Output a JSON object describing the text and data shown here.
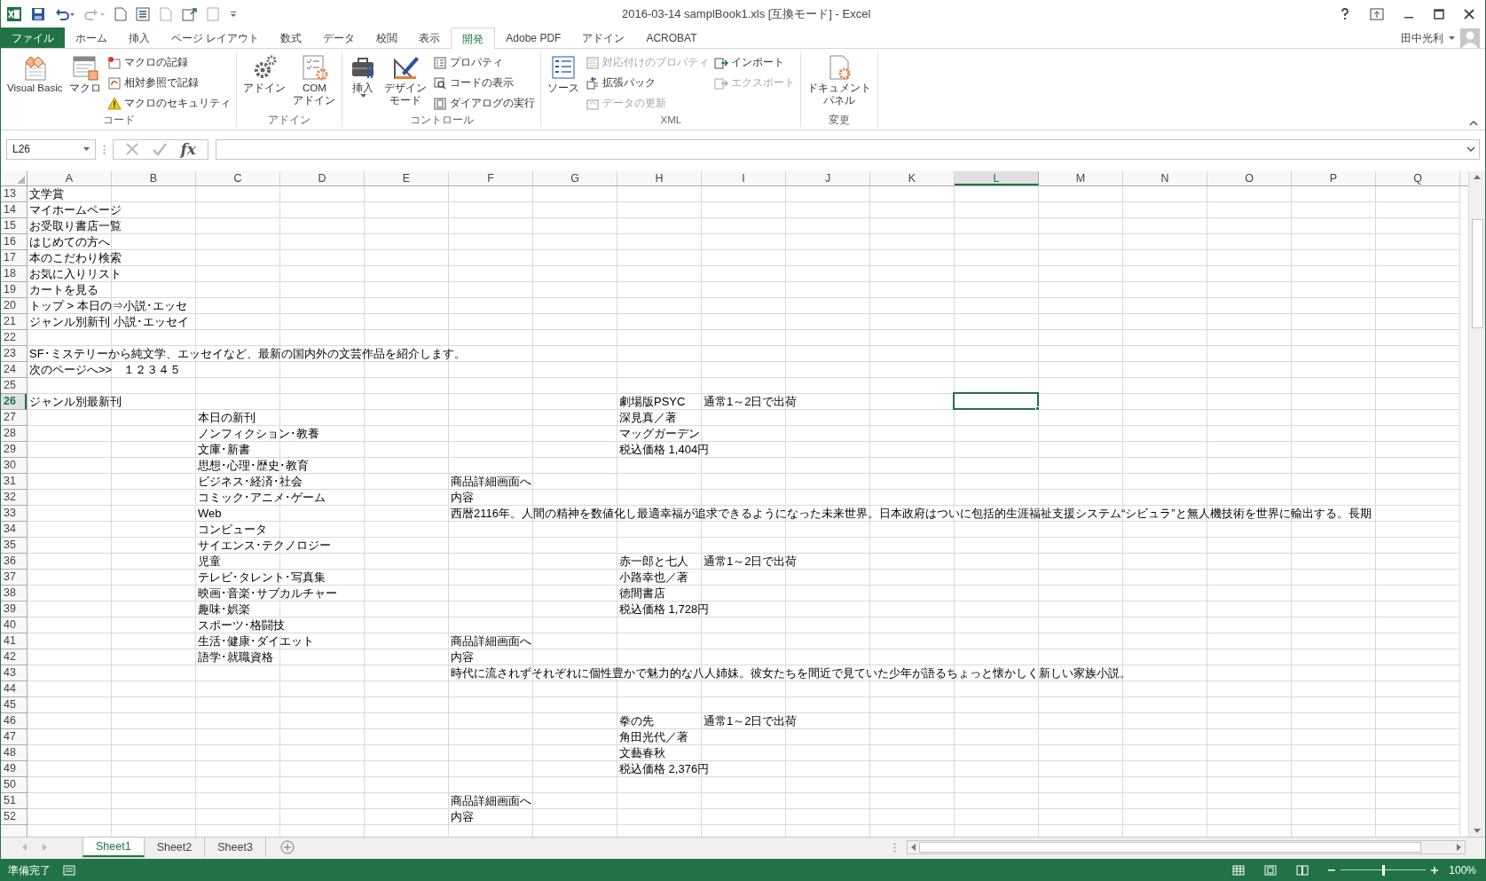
{
  "window": {
    "title": "2016-03-14 samplBook1.xls  [互換モード] - Excel",
    "user": "田中光利"
  },
  "tabs": [
    {
      "label": "ファイル",
      "kind": "file",
      "selected": false
    },
    {
      "label": "ホーム",
      "kind": "tab",
      "selected": false
    },
    {
      "label": "挿入",
      "kind": "tab",
      "selected": false
    },
    {
      "label": "ページ レイアウト",
      "kind": "tab",
      "selected": false
    },
    {
      "label": "数式",
      "kind": "tab",
      "selected": false
    },
    {
      "label": "データ",
      "kind": "tab",
      "selected": false
    },
    {
      "label": "校閲",
      "kind": "tab",
      "selected": false
    },
    {
      "label": "表示",
      "kind": "tab",
      "selected": false
    },
    {
      "label": "開発",
      "kind": "tab",
      "selected": true
    },
    {
      "label": "Adobe PDF",
      "kind": "tab",
      "selected": false
    },
    {
      "label": "アドイン",
      "kind": "tab",
      "selected": false
    },
    {
      "label": "ACROBAT",
      "kind": "tab",
      "selected": false
    }
  ],
  "ribbon": [
    {
      "label": "コード",
      "items": [
        {
          "kind": "large",
          "lines": [
            "Visual Basic"
          ],
          "disabled": false
        },
        {
          "kind": "large",
          "lines": [
            "マクロ"
          ],
          "disabled": false
        },
        {
          "kind": "small",
          "label": "マクロの記録",
          "disabled": false
        },
        {
          "kind": "small",
          "label": "相対参照で記録",
          "disabled": false
        },
        {
          "kind": "small",
          "label": "マクロのセキュリティ",
          "disabled": false
        }
      ]
    },
    {
      "label": "アドイン",
      "items": [
        {
          "kind": "large",
          "lines": [
            "アドイン"
          ],
          "disabled": false
        },
        {
          "kind": "large",
          "lines": [
            "COM",
            "アドイン"
          ],
          "disabled": false
        }
      ]
    },
    {
      "label": "コントロール",
      "items": [
        {
          "kind": "large",
          "lines": [
            "挿入"
          ],
          "disabled": false
        },
        {
          "kind": "large",
          "lines": [
            "デザイン",
            "モード"
          ],
          "disabled": false
        },
        {
          "kind": "small",
          "label": "プロパティ",
          "disabled": false
        },
        {
          "kind": "small",
          "label": "コードの表示",
          "disabled": false
        },
        {
          "kind": "small",
          "label": "ダイアログの実行",
          "disabled": false
        }
      ]
    },
    {
      "label": "XML",
      "items": [
        {
          "kind": "large",
          "lines": [
            "ソース"
          ],
          "disabled": false
        },
        {
          "kind": "small",
          "label": "対応付けのプロパティ",
          "disabled": true
        },
        {
          "kind": "small",
          "label": "拡張パック",
          "disabled": false
        },
        {
          "kind": "small",
          "label": "データの更新",
          "disabled": true
        },
        {
          "kind": "small",
          "label": "インポート",
          "disabled": false
        },
        {
          "kind": "small",
          "label": "エクスポート",
          "disabled": true
        }
      ]
    },
    {
      "label": "変更",
      "items": [
        {
          "kind": "large",
          "lines": [
            "ドキュメント",
            "パネル"
          ],
          "disabled": false
        }
      ]
    }
  ],
  "formula_bar": {
    "name_box": "L26",
    "function_label": "fx"
  },
  "columns": [
    {
      "label": "A",
      "selected": false
    },
    {
      "label": "B",
      "selected": false
    },
    {
      "label": "C",
      "selected": false
    },
    {
      "label": "D",
      "selected": false
    },
    {
      "label": "E",
      "selected": false
    },
    {
      "label": "F",
      "selected": false
    },
    {
      "label": "G",
      "selected": false
    },
    {
      "label": "H",
      "selected": false
    },
    {
      "label": "I",
      "selected": false
    },
    {
      "label": "J",
      "selected": false
    },
    {
      "label": "K",
      "selected": false
    },
    {
      "label": "L",
      "selected": true
    },
    {
      "label": "M",
      "selected": false
    },
    {
      "label": "N",
      "selected": false
    },
    {
      "label": "O",
      "selected": false
    },
    {
      "label": "P",
      "selected": false
    },
    {
      "label": "Q",
      "selected": false
    }
  ],
  "rows": [
    {
      "number": "13",
      "selected": false,
      "cells": {
        "A": "文学賞"
      }
    },
    {
      "number": "14",
      "selected": false,
      "cells": {
        "A": "マイホームページ"
      }
    },
    {
      "number": "15",
      "selected": false,
      "cells": {
        "A": "お受取り書店一覧"
      }
    },
    {
      "number": "16",
      "selected": false,
      "cells": {
        "A": "はじめての方へ"
      }
    },
    {
      "number": "17",
      "selected": false,
      "cells": {
        "A": "本のこだわり検索"
      }
    },
    {
      "number": "18",
      "selected": false,
      "cells": {
        "A": "お気に入りリスト"
      }
    },
    {
      "number": "19",
      "selected": false,
      "cells": {
        "A": "カートを見る"
      }
    },
    {
      "number": "20",
      "selected": false,
      "cells": {
        "A": "トップ > 本日の⇒小説･エッセ"
      }
    },
    {
      "number": "21",
      "selected": false,
      "cells": {
        "A": "ジャンル別新刊 小説･エッセイ"
      }
    },
    {
      "number": "22",
      "selected": false
    },
    {
      "number": "23",
      "selected": false,
      "cells": {
        "A": "SF･ミステリーから純文学、エッセイなど、最新の国内外の文芸作品を紹介します。"
      }
    },
    {
      "number": "24",
      "selected": false,
      "cells": {
        "A": "次のページへ>>　１２３４５"
      }
    },
    {
      "number": "25",
      "selected": false
    },
    {
      "number": "26",
      "selected": true,
      "cells": {
        "A": "ジャンル別最新刊",
        "H": "劇場版PSYC",
        "I": "通常1～2日で出荷"
      }
    },
    {
      "number": "27",
      "selected": false,
      "cells": {
        "C": "本日の新刊",
        "H": "深見真／著"
      }
    },
    {
      "number": "28",
      "selected": false,
      "cells": {
        "C": "ノンフィクション･教養",
        "H": "マッグガーデン"
      }
    },
    {
      "number": "29",
      "selected": false,
      "cells": {
        "C": "文庫･新書",
        "H": "税込価格 1,404円"
      }
    },
    {
      "number": "30",
      "selected": false,
      "cells": {
        "C": "思想･心理･歴史･教育"
      }
    },
    {
      "number": "31",
      "selected": false,
      "cells": {
        "C": "ビジネス･経済･社会",
        "F": "商品詳細画面へ"
      }
    },
    {
      "number": "32",
      "selected": false,
      "cells": {
        "C": "コミック･アニメ･ゲーム",
        "F": "内容"
      }
    },
    {
      "number": "33",
      "selected": false,
      "cells": {
        "C": "Web",
        "F": "西暦2116年。人間の精神を数値化し最適幸福が追求できるようになった未来世界。日本政府はついに包括的生涯福祉支援システム“シビュラ”と無人機技術を世界に輸出する。長期"
      }
    },
    {
      "number": "34",
      "selected": false,
      "cells": {
        "C": "コンピュータ"
      }
    },
    {
      "number": "35",
      "selected": false,
      "cells": {
        "C": "サイエンス･テクノロジー"
      }
    },
    {
      "number": "36",
      "selected": false,
      "cells": {
        "C": "児童",
        "H": "赤一郎と七人",
        "I": "通常1～2日で出荷"
      }
    },
    {
      "number": "37",
      "selected": false,
      "cells": {
        "C": "テレビ･タレント･写真集",
        "H": "小路幸也／著"
      }
    },
    {
      "number": "38",
      "selected": false,
      "cells": {
        "C": "映画･音楽･サブカルチャー",
        "H": "徳間書店"
      }
    },
    {
      "number": "39",
      "selected": false,
      "cells": {
        "C": "趣味･娯楽",
        "H": "税込価格 1,728円"
      }
    },
    {
      "number": "40",
      "selected": false,
      "cells": {
        "C": "スポーツ･格闘技"
      }
    },
    {
      "number": "41",
      "selected": false,
      "cells": {
        "C": "生活･健康･ダイエット",
        "F": "商品詳細画面へ"
      }
    },
    {
      "number": "42",
      "selected": false,
      "cells": {
        "C": "語学･就職資格",
        "F": "内容"
      }
    },
    {
      "number": "43",
      "selected": false,
      "cells": {
        "F": "時代に流されずそれぞれに個性豊かで魅力的な八人姉妹。彼女たちを間近で見ていた少年が語るちょっと懐かしく新しい家族小説。"
      }
    },
    {
      "number": "44",
      "selected": false
    },
    {
      "number": "45",
      "selected": false
    },
    {
      "number": "46",
      "selected": false,
      "cells": {
        "H": "拳の先",
        "I": "通常1～2日で出荷"
      }
    },
    {
      "number": "47",
      "selected": false,
      "cells": {
        "H": "角田光代／著"
      }
    },
    {
      "number": "48",
      "selected": false,
      "cells": {
        "H": "文藝春秋"
      }
    },
    {
      "number": "49",
      "selected": false,
      "cells": {
        "H": "税込価格 2,376円"
      }
    },
    {
      "number": "50",
      "selected": false
    },
    {
      "number": "51",
      "selected": false,
      "cells": {
        "F": "商品詳細画面へ"
      }
    },
    {
      "number": "52",
      "selected": false,
      "cells": {
        "F": "内容"
      }
    }
  ],
  "sheets": [
    {
      "label": "Sheet1",
      "selected": true
    },
    {
      "label": "Sheet2",
      "selected": false
    },
    {
      "label": "Sheet3",
      "selected": false
    }
  ],
  "status_bar": {
    "status": "準備完了",
    "zoom": "100%",
    "zoom_slider": {
      "level": 0.5
    }
  }
}
